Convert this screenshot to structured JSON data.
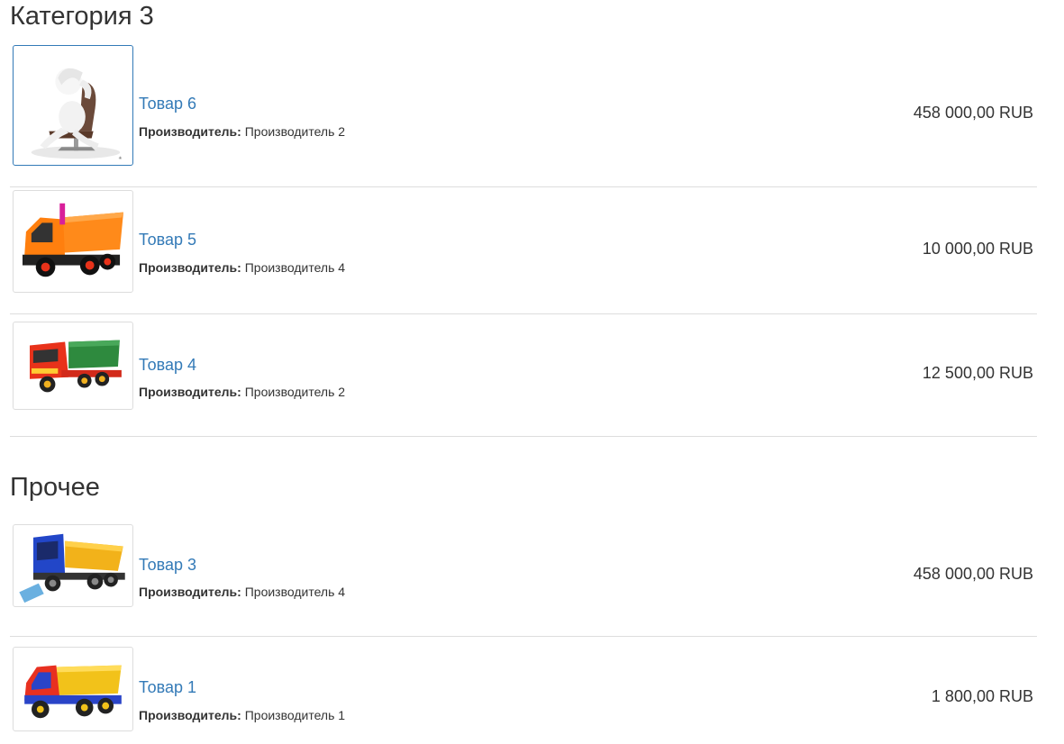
{
  "categories": [
    {
      "title": "Категория 3",
      "items": [
        {
          "name": "Товар 6",
          "maker_label": "Производитель:",
          "maker": "Производитель 2",
          "price": "458 000,00 RUB",
          "image": "figure-in-chair-icon"
        },
        {
          "name": "Товар 5",
          "maker_label": "Производитель:",
          "maker": "Производитель 4",
          "price": "10 000,00 RUB",
          "image": "orange-dump-truck-icon"
        },
        {
          "name": "Товар 4",
          "maker_label": "Производитель:",
          "maker": "Производитель 2",
          "price": "12 500,00 RUB",
          "image": "red-green-truck-icon"
        }
      ]
    },
    {
      "title": "Прочее",
      "items": [
        {
          "name": "Товар 3",
          "maker_label": "Производитель:",
          "maker": "Производитель 4",
          "price": "458 000,00 RUB",
          "image": "blue-yellow-truck-icon"
        },
        {
          "name": "Товар 1",
          "maker_label": "Производитель:",
          "maker": "Производитель 1",
          "price": "1 800,00 RUB",
          "image": "red-yellow-truck-icon"
        }
      ]
    }
  ],
  "colors": {
    "link": "#337ab7",
    "text": "#333333",
    "separator": "#dddddd"
  }
}
